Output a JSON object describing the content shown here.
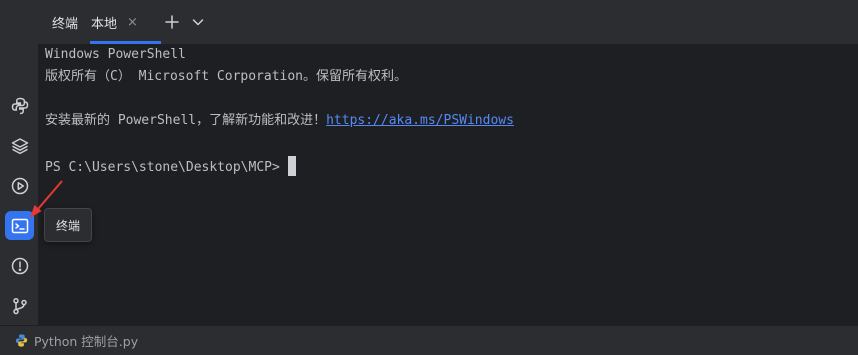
{
  "tabs": {
    "title": "终端",
    "local_tab": "本地",
    "close_glyph": "×",
    "new_glyph": "+",
    "dropdown_glyph": "⌄"
  },
  "terminal": {
    "line1": "Windows PowerShell",
    "line2": "版权所有（C） Microsoft Corporation。保留所有权利。",
    "line3_prefix": "安装最新的 PowerShell，了解新功能和改进！",
    "line3_link": "https://aka.ms/PSWindows",
    "prompt": "PS C:\\Users\\stone\\Desktop\\MCP>"
  },
  "tooltip": {
    "text": "终端"
  },
  "statusbar": {
    "file": "Python 控制台.py"
  },
  "colors": {
    "accent": "#3574f0",
    "link": "#548af7",
    "arrow": "#e53935",
    "python_blue": "#4a8ad6",
    "python_yellow": "#e6c14a"
  },
  "icons": [
    "python-icon",
    "layers-icon",
    "run-icon",
    "terminal-icon",
    "problems-icon",
    "git-icon"
  ]
}
